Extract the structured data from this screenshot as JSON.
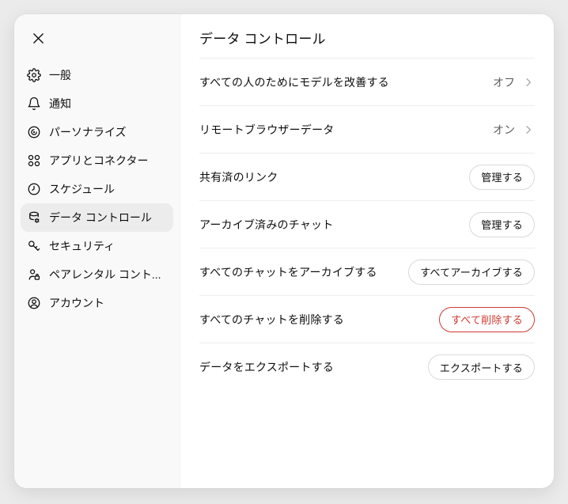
{
  "sidebar": {
    "items": [
      {
        "id": "general",
        "icon": "gear",
        "label": "一般"
      },
      {
        "id": "notifications",
        "icon": "bell",
        "label": "通知"
      },
      {
        "id": "personalization",
        "icon": "personalize",
        "label": "パーソナライズ"
      },
      {
        "id": "apps-connectors",
        "icon": "apps",
        "label": "アプリとコネクター"
      },
      {
        "id": "schedule",
        "icon": "clock",
        "label": "スケジュール"
      },
      {
        "id": "data-controls",
        "icon": "database",
        "label": "データ コントロール",
        "selected": true
      },
      {
        "id": "security",
        "icon": "key",
        "label": "セキュリティ"
      },
      {
        "id": "parental-controls",
        "icon": "parental",
        "label": "ペアレンタル コント..."
      },
      {
        "id": "account",
        "icon": "account",
        "label": "アカウント"
      }
    ]
  },
  "main": {
    "title": "データ コントロール",
    "rows": [
      {
        "id": "improve-model",
        "type": "nav",
        "label": "すべての人のためにモデルを改善する",
        "value": "オフ"
      },
      {
        "id": "remote-browser-data",
        "type": "nav",
        "label": "リモートブラウザーデータ",
        "value": "オン"
      },
      {
        "id": "shared-links",
        "type": "button",
        "label": "共有済のリンク",
        "action": "管理する"
      },
      {
        "id": "archived-chats",
        "type": "button",
        "label": "アーカイブ済みのチャット",
        "action": "管理する"
      },
      {
        "id": "archive-all-chats",
        "type": "button",
        "label": "すべてのチャットをアーカイブする",
        "action": "すべてアーカイブする"
      },
      {
        "id": "delete-all-chats",
        "type": "button",
        "label": "すべてのチャットを削除する",
        "action": "すべて削除する",
        "danger": true
      },
      {
        "id": "export-data",
        "type": "button",
        "label": "データをエクスポートする",
        "action": "エクスポートする"
      }
    ]
  },
  "colors": {
    "danger": "#cf3a30",
    "sidebar_bg": "#f9f9f9",
    "selected_item_bg": "#ececec",
    "divider": "#ededed"
  }
}
